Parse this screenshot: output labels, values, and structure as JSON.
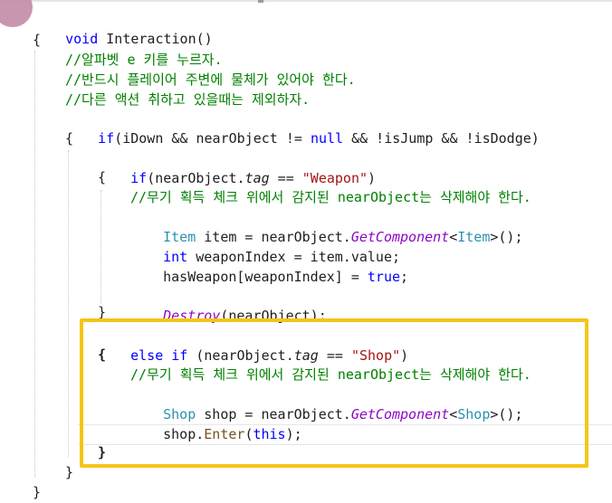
{
  "code": {
    "l1": {
      "kw": "void",
      "name": " Interaction()"
    },
    "l2": "{",
    "l3": "//알파벳 e 키를 누르자.",
    "l4": "//반드시 플레이어 주변에 물체가 있어야 한다.",
    "l5": "//다른 액션 취하고 있을때는 제외하자.",
    "l6": {
      "kw_if": "if",
      "a": "(iDown && nearObject != ",
      "kw_null": "null",
      "b": " && !isJump && !isDodge)"
    },
    "l7": "{",
    "l8": {
      "kw_if": "if",
      "a": "(nearObject.",
      "tag": "tag",
      "b": " == ",
      "str": "\"Weapon\"",
      "c": ")"
    },
    "l9": "{",
    "l10": "//무기 획득 체크 위에서 감지된 nearObject는 삭제해야 한다.",
    "l11": {
      "type": "Item",
      "a": " item = nearObject.",
      "method": "GetComponent",
      "lt": "<",
      "type2": "Item",
      "b": ">();"
    },
    "l12": {
      "kw": "int",
      "a": " weaponIndex = item.value;"
    },
    "l13": {
      "a": "hasWeapon[weaponIndex] = ",
      "kw": "true",
      "b": ";"
    },
    "l15": {
      "method": "Destroy",
      "a": "(nearObject);"
    },
    "l16": "}",
    "l17": {
      "kw": "else if",
      "a": " (nearObject.",
      "tag": "tag",
      "b": " == ",
      "str": "\"Shop\"",
      "c": ")"
    },
    "l18": "{",
    "l19": "//무기 획득 체크 위에서 감지된 nearObject는 삭제해야 한다.",
    "l20": {
      "type": "Shop",
      "a": " shop = nearObject.",
      "method": "GetComponent",
      "lt": "<",
      "type2": "Shop",
      "b": ">();"
    },
    "l21": {
      "a": "shop.",
      "method": "Enter",
      "b": "(",
      "kw": "this",
      "c": ");"
    },
    "l23": "}",
    "l24": "}",
    "l25": "}"
  },
  "colors": {
    "keyword": "#0000ff",
    "type": "#2b91af",
    "comment": "#008000",
    "string": "#a31515",
    "highlight_border": "#f5c518"
  }
}
